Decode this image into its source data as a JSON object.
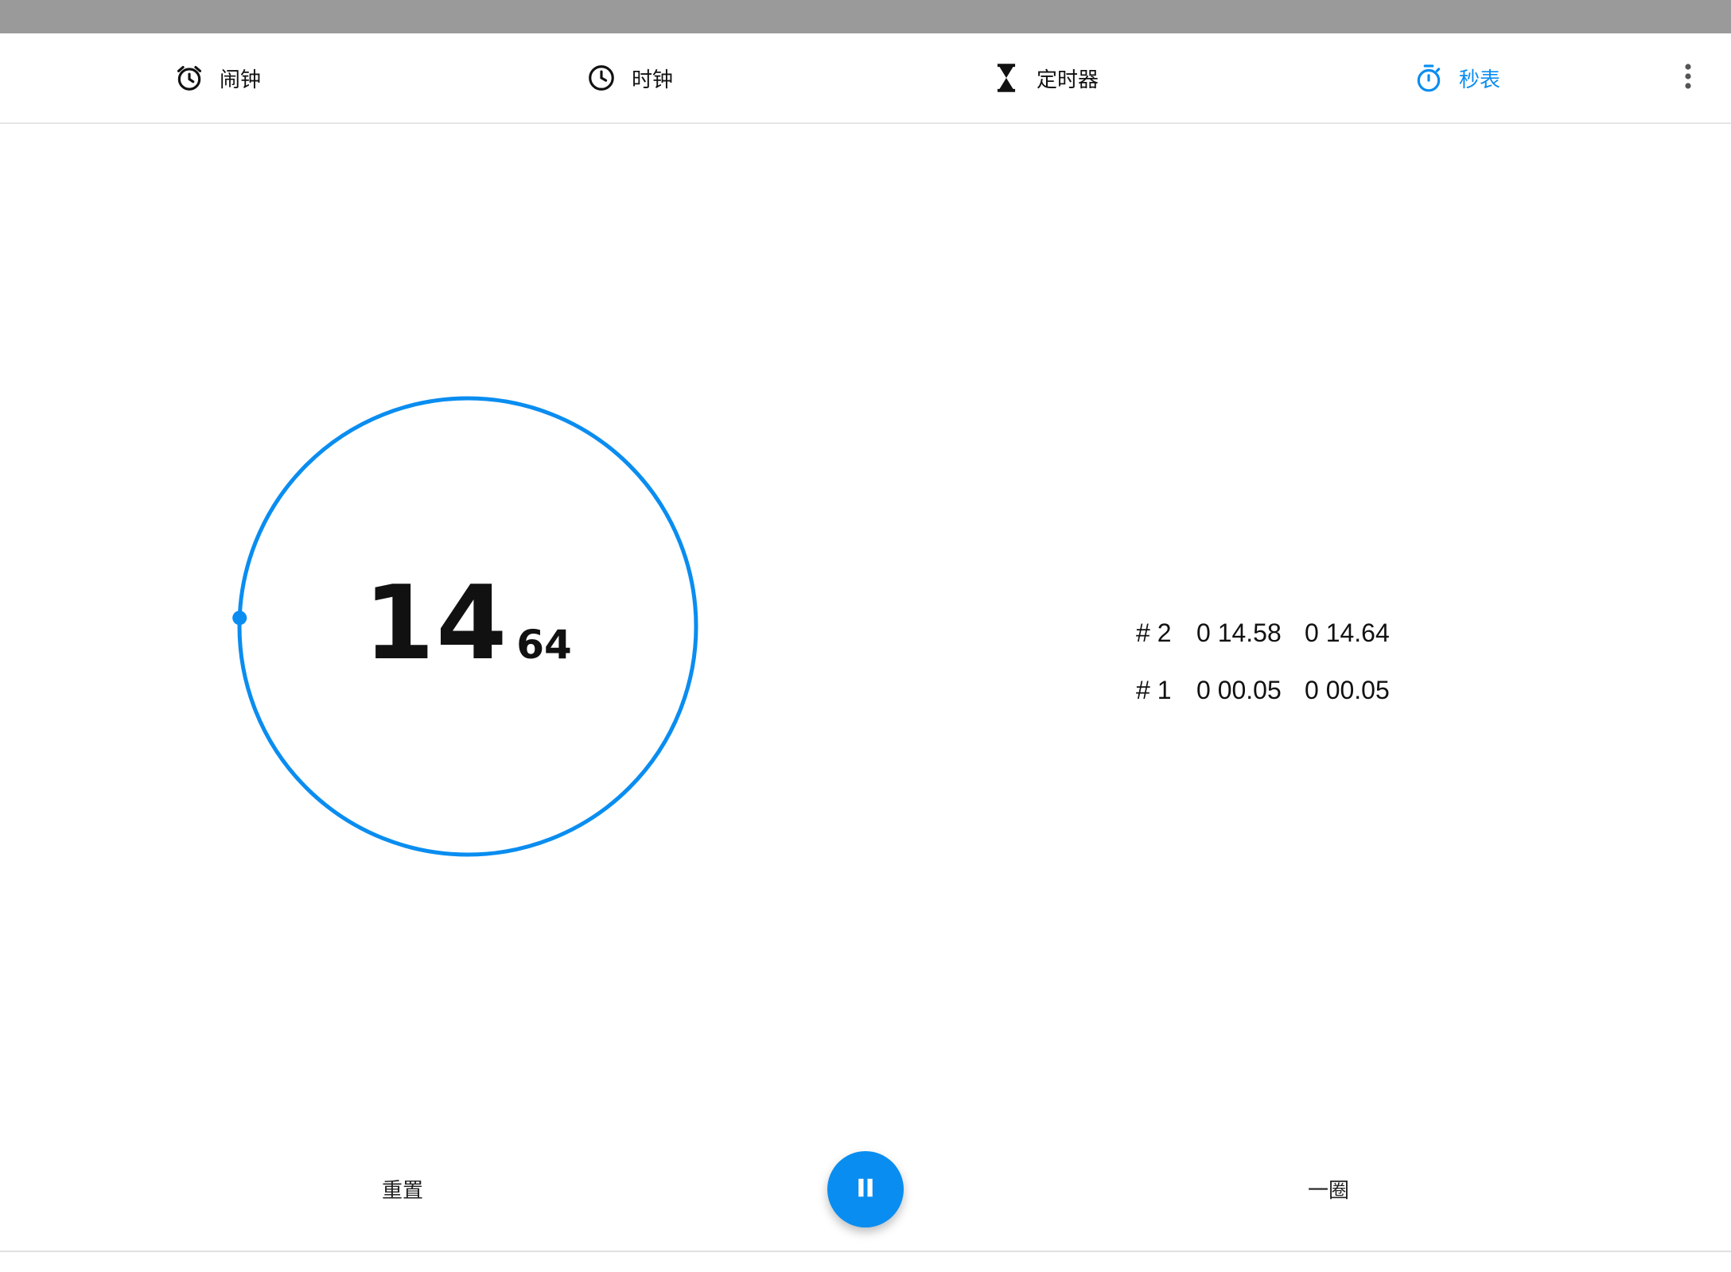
{
  "tabs": [
    {
      "label": "闹钟",
      "icon": "alarm-clock-icon",
      "active": false
    },
    {
      "label": "时钟",
      "icon": "clock-icon",
      "active": false
    },
    {
      "label": "定时器",
      "icon": "hourglass-icon",
      "active": false
    },
    {
      "label": "秒表",
      "icon": "stopwatch-icon",
      "active": true
    }
  ],
  "overflow_menu": {
    "icon": "more-vert-icon"
  },
  "stopwatch": {
    "seconds": "14",
    "hundredths": "64",
    "progress_fraction": 0.244
  },
  "laps": [
    {
      "number": "# 2",
      "lap_time": "0 14.58",
      "total_time": "0 14.64"
    },
    {
      "number": "# 1",
      "lap_time": "0 00.05",
      "total_time": "0 00.05"
    }
  ],
  "controls": {
    "reset_label": "重置",
    "lap_label": "一圈",
    "pause_icon": "pause-icon"
  },
  "colors": {
    "accent": "#0a8df0",
    "status_bar": "#9a9a9a",
    "text": "#111111"
  }
}
